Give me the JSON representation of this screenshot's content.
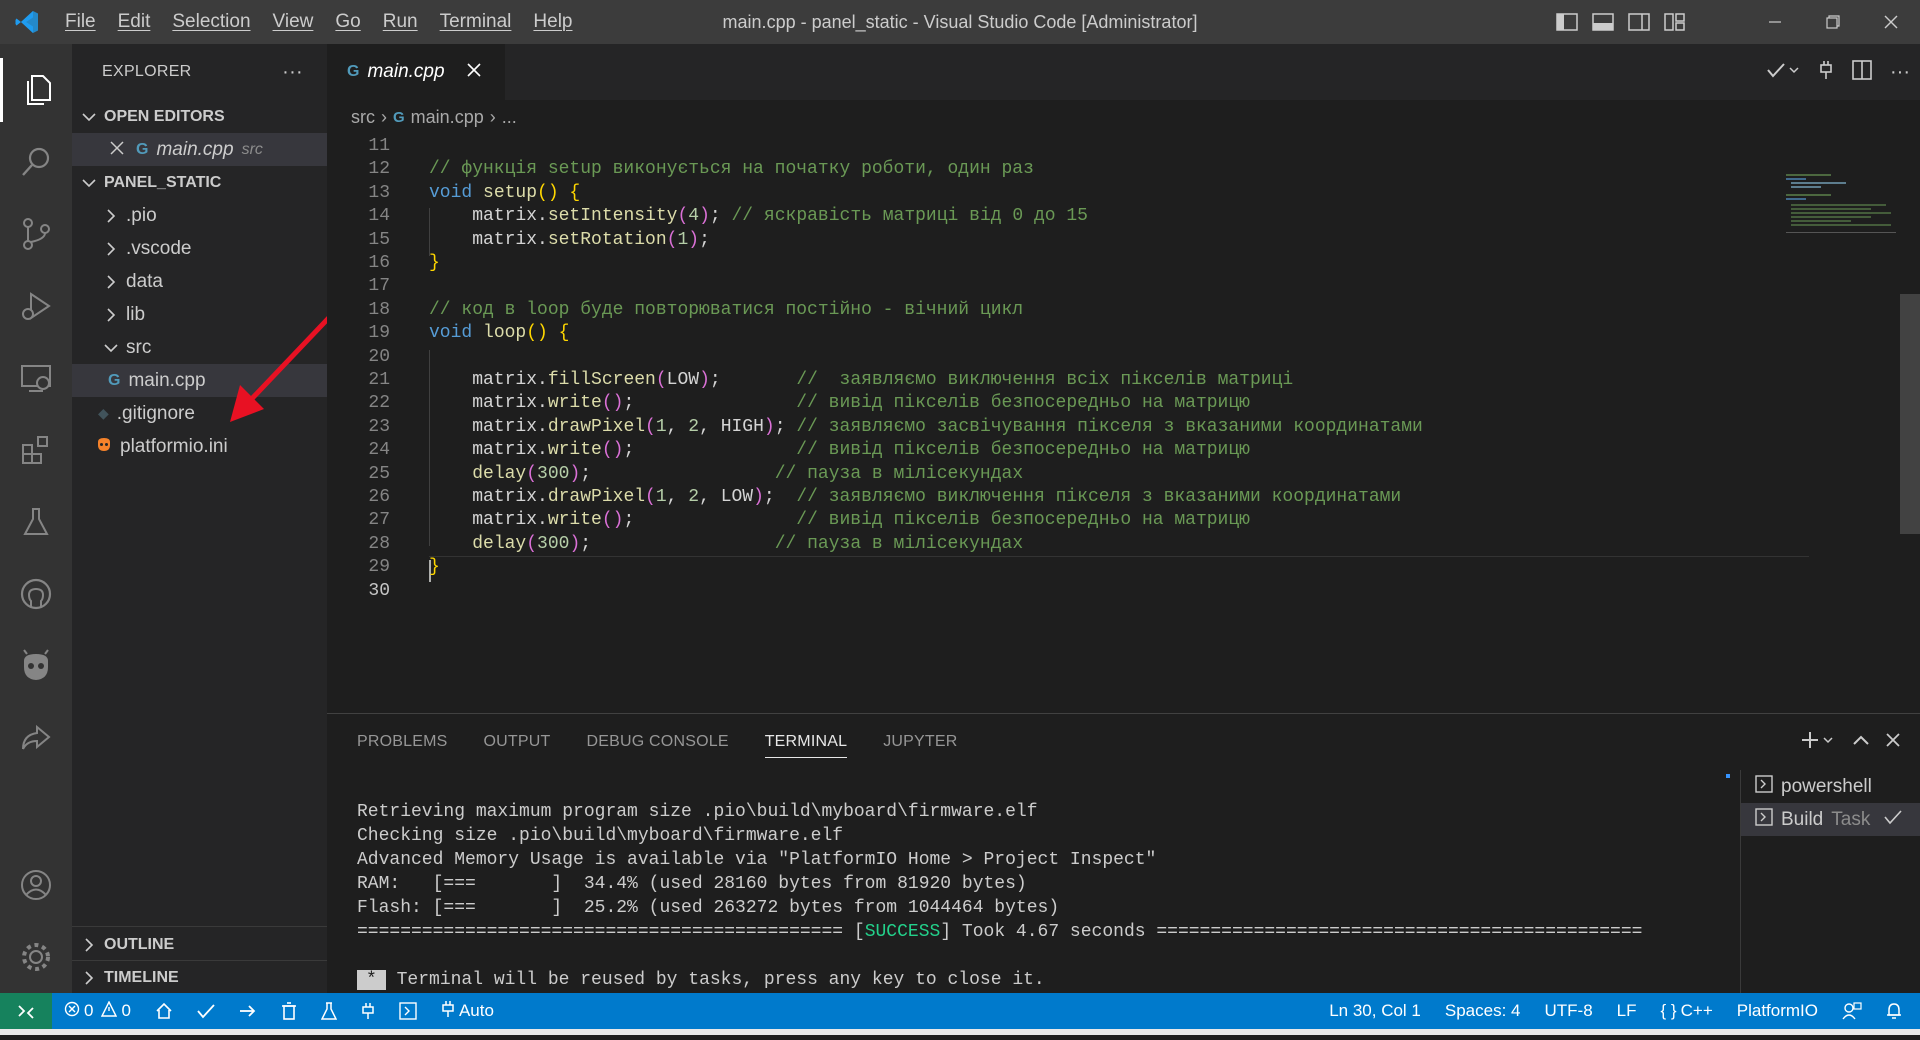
{
  "window": {
    "title": "main.cpp - panel_static - Visual Studio Code [Administrator]",
    "menu": [
      "File",
      "Edit",
      "Selection",
      "View",
      "Go",
      "Run",
      "Terminal",
      "Help"
    ]
  },
  "sidebar": {
    "title": "EXPLORER",
    "more": "···",
    "open_editors_label": "OPEN EDITORS",
    "open_editor": {
      "name": "main.cpp",
      "dir": "src"
    },
    "project_label": "PANEL_STATIC",
    "tree": [
      {
        "label": ".pio"
      },
      {
        "label": ".vscode"
      },
      {
        "label": "data"
      },
      {
        "label": "lib"
      },
      {
        "label": "src"
      },
      {
        "label": "main.cpp"
      },
      {
        "label": ".gitignore"
      },
      {
        "label": "platformio.ini"
      }
    ],
    "outline_label": "OUTLINE",
    "timeline_label": "TIMELINE"
  },
  "editor": {
    "tab": "main.cpp",
    "breadcrumb": [
      "src",
      "main.cpp",
      "..."
    ],
    "lines": [
      {
        "n": "11",
        "segs": []
      },
      {
        "n": "12",
        "segs": [
          [
            "cm",
            "// функція setup виконується на початку роботи, один раз"
          ]
        ]
      },
      {
        "n": "13",
        "segs": [
          [
            "kw",
            "void "
          ],
          [
            "fn",
            "setup"
          ],
          [
            "br",
            "() {"
          ]
        ]
      },
      {
        "n": "14",
        "segs": [
          [
            "",
            "    matrix."
          ],
          [
            "fn",
            "setIntensity"
          ],
          [
            "br2",
            "("
          ],
          [
            "num",
            "4"
          ],
          [
            "br2",
            ")"
          ],
          [
            "",
            ";"
          ],
          [
            "cm",
            " // яскравість матриці від 0 до 15"
          ]
        ]
      },
      {
        "n": "15",
        "segs": [
          [
            "",
            "    matrix."
          ],
          [
            "fn",
            "setRotation"
          ],
          [
            "br2",
            "("
          ],
          [
            "num",
            "1"
          ],
          [
            "br2",
            ")"
          ],
          [
            "",
            ";"
          ]
        ]
      },
      {
        "n": "16",
        "segs": [
          [
            "br",
            "}"
          ]
        ]
      },
      {
        "n": "17",
        "segs": []
      },
      {
        "n": "18",
        "segs": [
          [
            "cm",
            "// код в loop буде повторюватися постійно - вічний цикл"
          ]
        ]
      },
      {
        "n": "19",
        "segs": [
          [
            "kw",
            "void "
          ],
          [
            "fn",
            "loop"
          ],
          [
            "br",
            "() {"
          ]
        ]
      },
      {
        "n": "20",
        "segs": []
      },
      {
        "n": "21",
        "segs": [
          [
            "",
            "    matrix."
          ],
          [
            "fn",
            "fillScreen"
          ],
          [
            "br2",
            "("
          ],
          [
            "",
            "LOW"
          ],
          [
            "br2",
            ")"
          ],
          [
            "",
            ";       "
          ],
          [
            "cm",
            "//  заявляємо виключення всіх пікселів матриці"
          ]
        ]
      },
      {
        "n": "22",
        "segs": [
          [
            "",
            "    matrix."
          ],
          [
            "fn",
            "write"
          ],
          [
            "br2",
            "()"
          ],
          [
            "",
            ";               "
          ],
          [
            "cm",
            "// вивід пікселів безпосередньо на матрицю"
          ]
        ]
      },
      {
        "n": "23",
        "segs": [
          [
            "",
            "    matrix."
          ],
          [
            "fn",
            "drawPixel"
          ],
          [
            "br2",
            "("
          ],
          [
            "num",
            "1"
          ],
          [
            "",
            ", "
          ],
          [
            "num",
            "2"
          ],
          [
            "",
            ", HIGH"
          ],
          [
            "br2",
            ")"
          ],
          [
            "",
            "; "
          ],
          [
            "cm",
            "// заявляємо засвічування пікселя з вказаними координатами"
          ]
        ]
      },
      {
        "n": "24",
        "segs": [
          [
            "",
            "    matrix."
          ],
          [
            "fn",
            "write"
          ],
          [
            "br2",
            "()"
          ],
          [
            "",
            ";               "
          ],
          [
            "cm",
            "// вивід пікселів безпосередньо на матрицю"
          ]
        ]
      },
      {
        "n": "25",
        "segs": [
          [
            "",
            "    "
          ],
          [
            "fn",
            "delay"
          ],
          [
            "br2",
            "("
          ],
          [
            "num",
            "300"
          ],
          [
            "br2",
            ")"
          ],
          [
            "",
            ";                 "
          ],
          [
            "cm",
            "// пауза в мілісекундах"
          ]
        ]
      },
      {
        "n": "26",
        "segs": [
          [
            "",
            "    matrix."
          ],
          [
            "fn",
            "drawPixel"
          ],
          [
            "br2",
            "("
          ],
          [
            "num",
            "1"
          ],
          [
            "",
            ", "
          ],
          [
            "num",
            "2"
          ],
          [
            "",
            ", LOW"
          ],
          [
            "br2",
            ")"
          ],
          [
            "",
            ";  "
          ],
          [
            "cm",
            "// заявляємо виключення пікселя з вказаними координатами"
          ]
        ]
      },
      {
        "n": "27",
        "segs": [
          [
            "",
            "    matrix."
          ],
          [
            "fn",
            "write"
          ],
          [
            "br2",
            "()"
          ],
          [
            "",
            ";               "
          ],
          [
            "cm",
            "// вивід пікселів безпосередньо на матрицю"
          ]
        ]
      },
      {
        "n": "28",
        "segs": [
          [
            "",
            "    "
          ],
          [
            "fn",
            "delay"
          ],
          [
            "br2",
            "("
          ],
          [
            "num",
            "300"
          ],
          [
            "br2",
            ")"
          ],
          [
            "",
            ";                 "
          ],
          [
            "cm",
            "// пауза в мілісекундах"
          ]
        ]
      },
      {
        "n": "29",
        "segs": [
          [
            "br",
            "}"
          ]
        ]
      },
      {
        "n": "30",
        "segs": []
      }
    ]
  },
  "panel": {
    "tabs": [
      "PROBLEMS",
      "OUTPUT",
      "DEBUG CONSOLE",
      "TERMINAL",
      "JUPYTER"
    ],
    "active_tab": "TERMINAL",
    "terminal_lines": [
      "Retrieving maximum program size .pio\\build\\myboard\\firmware.elf",
      "Checking size .pio\\build\\myboard\\firmware.elf",
      "Advanced Memory Usage is available via \"PlatformIO Home > Project Inspect\"",
      "RAM:   [===       ]  34.4% (used 28160 bytes from 81920 bytes)",
      "Flash: [===       ]  25.2% (used 263272 bytes from 1044464 bytes)"
    ],
    "success_pre": "============================================= [",
    "success_word": "SUCCESS",
    "success_post": "] Took 4.67 seconds =============================================",
    "reuse_marker": "*",
    "reuse_text": " Terminal will be reused by tasks, press any key to close it.",
    "terminals": [
      {
        "name": "powershell",
        "extra": ""
      },
      {
        "name": "Build",
        "extra": "Task"
      }
    ]
  },
  "statusbar": {
    "errors": "0",
    "warnings": "0",
    "auto": "Auto",
    "position": "Ln 30, Col 1",
    "spaces": "Spaces: 4",
    "encoding": "UTF-8",
    "eol": "LF",
    "language": "C++",
    "platform": "PlatformIO"
  },
  "colors": {
    "accent": "#007acc",
    "success": "#23d18b",
    "annotation_arrow": "#e81123"
  }
}
